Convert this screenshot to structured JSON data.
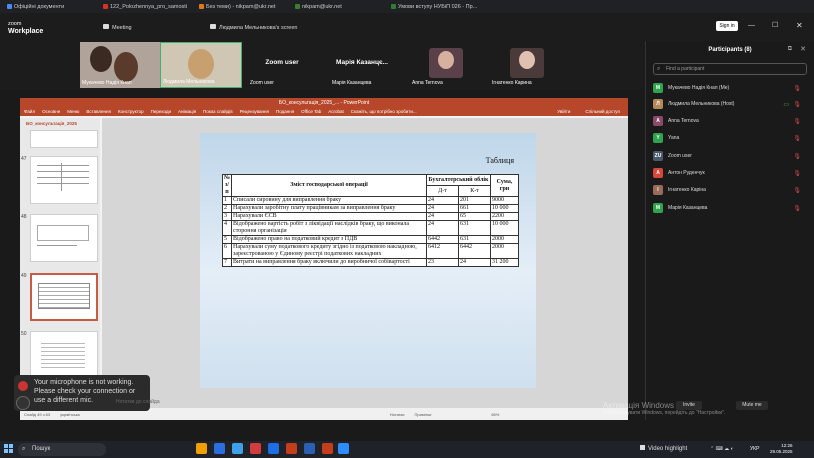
{
  "browser": {
    "tabs": [
      {
        "label": "Офіційні документи",
        "color": "#4a8af4"
      },
      {
        "label": "122_Polozhennya_pro_samosti",
        "color": "#d93025"
      },
      {
        "label": "Без теми) - nikpam@ukr.net",
        "color": "#e07a10"
      },
      {
        "label": "nikpam@ukr.net",
        "color": "#3c7d2e"
      },
      {
        "label": "Умови вступу НУБіП 026 - Пр...",
        "color": "#2e7d32"
      }
    ]
  },
  "zoom": {
    "app_name_1": "zoom",
    "app_name_2": "Workplace",
    "tab_label": "Meeting",
    "meeting_title": "Людмила Мельникова's screen",
    "signin": "Sign in",
    "videos": [
      {
        "name": "Мукачево Надія Кнап"
      },
      {
        "name": "Людмила Мельникова"
      },
      {
        "name": "Zoom user",
        "big": "Zoom user"
      },
      {
        "name": "Марія Казанцева",
        "big": "Марія Казанцє..."
      },
      {
        "name": "Anna Ternova"
      },
      {
        "name": "Ігнатенко Карина"
      }
    ]
  },
  "ppt": {
    "title": "БО_консультація_2025_... - PowerPoint",
    "menu": [
      "Файл",
      "Основне",
      "Меню",
      "Вставлення",
      "Конструктор",
      "Переходи",
      "Анімація",
      "Показ слайдів",
      "Рецензування",
      "Подання",
      "Office Tab",
      "Acrobat",
      "Скажіть, що потрібно зробити..."
    ],
    "user": "Увійти",
    "share": "Спільний доступ",
    "doc_tab": "БО_консультація_2025",
    "thumbs": [
      {
        "num": "47"
      },
      {
        "num": "48"
      },
      {
        "num": "49"
      },
      {
        "num": "50"
      }
    ],
    "status": [
      "Слайд 49 з 63",
      "українська",
      "Нотатки",
      "Примітки",
      "65%"
    ]
  },
  "slide": {
    "caption": "Таблиця",
    "headers": {
      "num": "№ з/п",
      "content": "Зміст господарської операції",
      "accounting": "Бухгалтерський облік",
      "sum": "Сума, грн",
      "dt": "Д-т",
      "kt": "К-т"
    },
    "rows": [
      {
        "n": "1",
        "text": "Списали сировину для виправлення браку",
        "dt": "24",
        "kt": "201",
        "sum": "9000"
      },
      {
        "n": "2",
        "text": "Нарахували заробітну плату працівникам за виправлення браку",
        "dt": "24",
        "kt": "661",
        "sum": "10 000"
      },
      {
        "n": "3",
        "text": "Нарахували ЄСВ",
        "dt": "24",
        "kt": "65",
        "sum": "2200"
      },
      {
        "n": "4",
        "text": "Відображено вартість робіт з ліквідації наслідків браку, що виконала стороння організація",
        "dt": "24",
        "kt": "631",
        "sum": "10 000"
      },
      {
        "n": "5",
        "text": "Відображено право на податковий кредит з ПДВ",
        "dt": "6442",
        "kt": "631",
        "sum": "2000"
      },
      {
        "n": "6",
        "text": "Нарахували суму податкового кредиту згідно із податковою накладною, зареєстрованою у Єдиному реєстрі податкових накладних",
        "dt": "6412",
        "kt": "6442",
        "sum": "2000"
      },
      {
        "n": "7",
        "text": "Витрати на виправлення браку включили до виробничої собівартості",
        "dt": "23",
        "kt": "24",
        "sum": "31 200"
      }
    ]
  },
  "participants": {
    "title": "Participants (8)",
    "search_placeholder": "Find a participant",
    "list": [
      {
        "name": "Мукачево Надія Кнап (Me)",
        "initial": "M",
        "color": "#2ea44f"
      },
      {
        "name": "Людмила Мельникова (Host)",
        "initial": "Л",
        "color": "#b58a5a"
      },
      {
        "name": "Anna Ternova",
        "initial": "A",
        "color": "#8a4a6a"
      },
      {
        "name": "Yana",
        "initial": "Y",
        "color": "#2ea44f"
      },
      {
        "name": "Zoom user",
        "initial": "ZU",
        "color": "#4a5a6a"
      },
      {
        "name": "Антон Руденчук",
        "initial": "A",
        "color": "#d9473b"
      },
      {
        "name": "Ігнатенко Каріна",
        "initial": "І",
        "color": "#9a6a5a"
      },
      {
        "name": "Марія Казанцева",
        "initial": "M",
        "color": "#2ea44f"
      }
    ],
    "invite": "Invite",
    "mute_me": "Mute me"
  },
  "toast": {
    "text": "Your microphone is not working. Please check your connection or use a different mic."
  },
  "behind_text": "Нотатки до слайда",
  "activate": {
    "line1": "Активація Windows",
    "line2": "Щоб активувати Windows, перейдіть до \"Настройки\"."
  },
  "taskbar": {
    "search": "Пошук",
    "video_highlight": "Video highlight",
    "lang": "УКР",
    "time": "12:26",
    "date": "29.05.2025"
  }
}
